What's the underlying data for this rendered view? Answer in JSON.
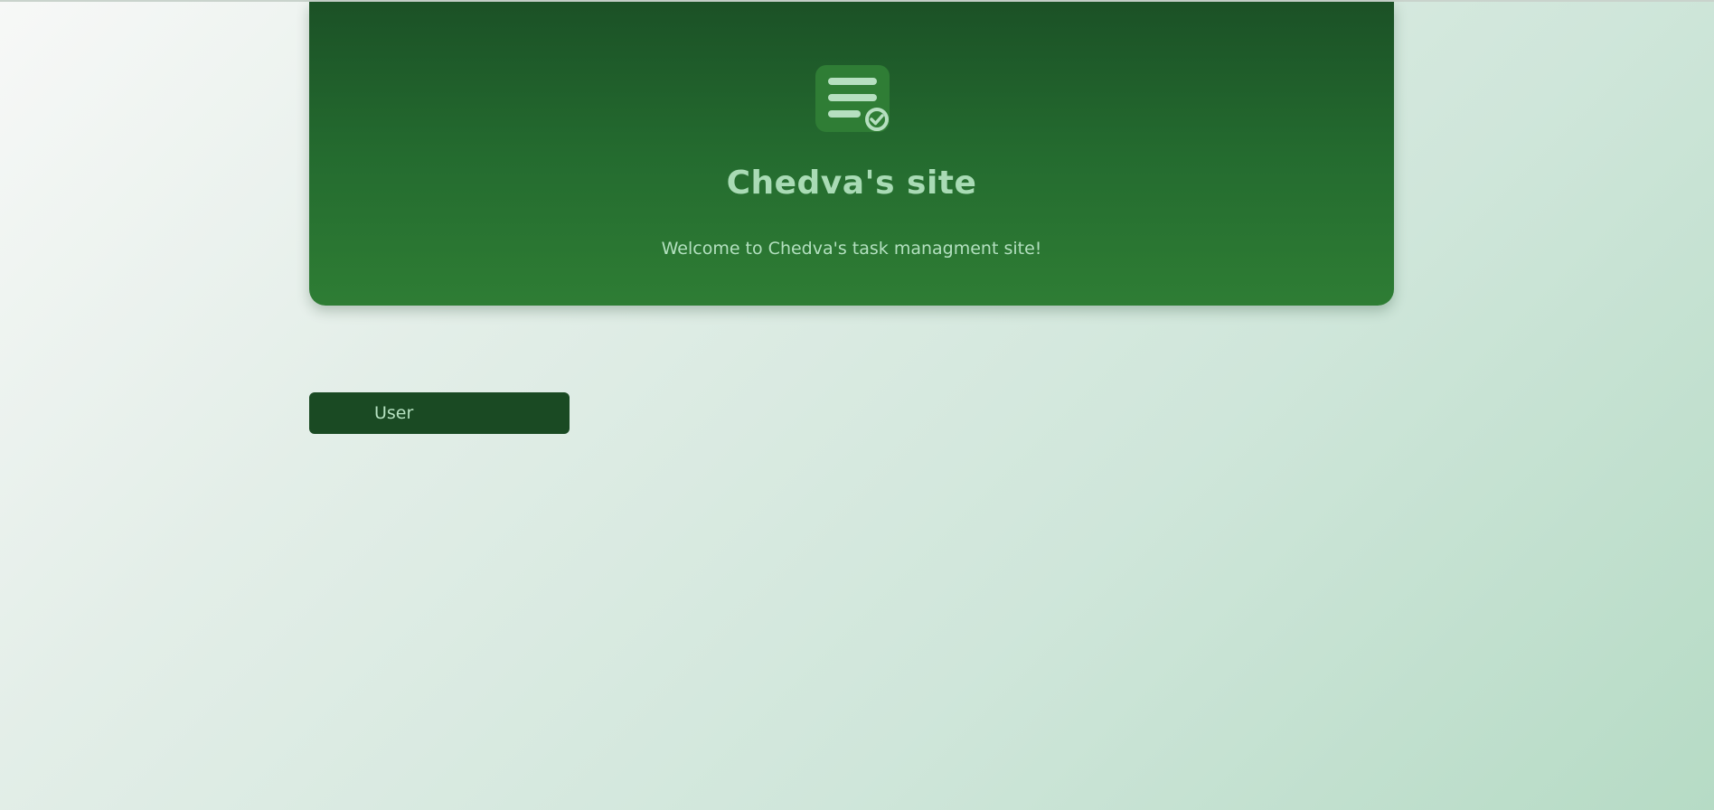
{
  "header": {
    "title": "Chedva's site",
    "subtitle": "Welcome to Chedva's task managment site!",
    "logo_icon": "task-list-check-icon"
  },
  "nav": {
    "user_button_label": "User"
  },
  "colors": {
    "header_dark": "#1b5126",
    "header_light": "#2e7d34",
    "button_bg": "#1a4a23",
    "text_accent": "#a9dbb5",
    "icon_bg": "#2e7d34",
    "icon_lines": "#b6dfc0"
  }
}
